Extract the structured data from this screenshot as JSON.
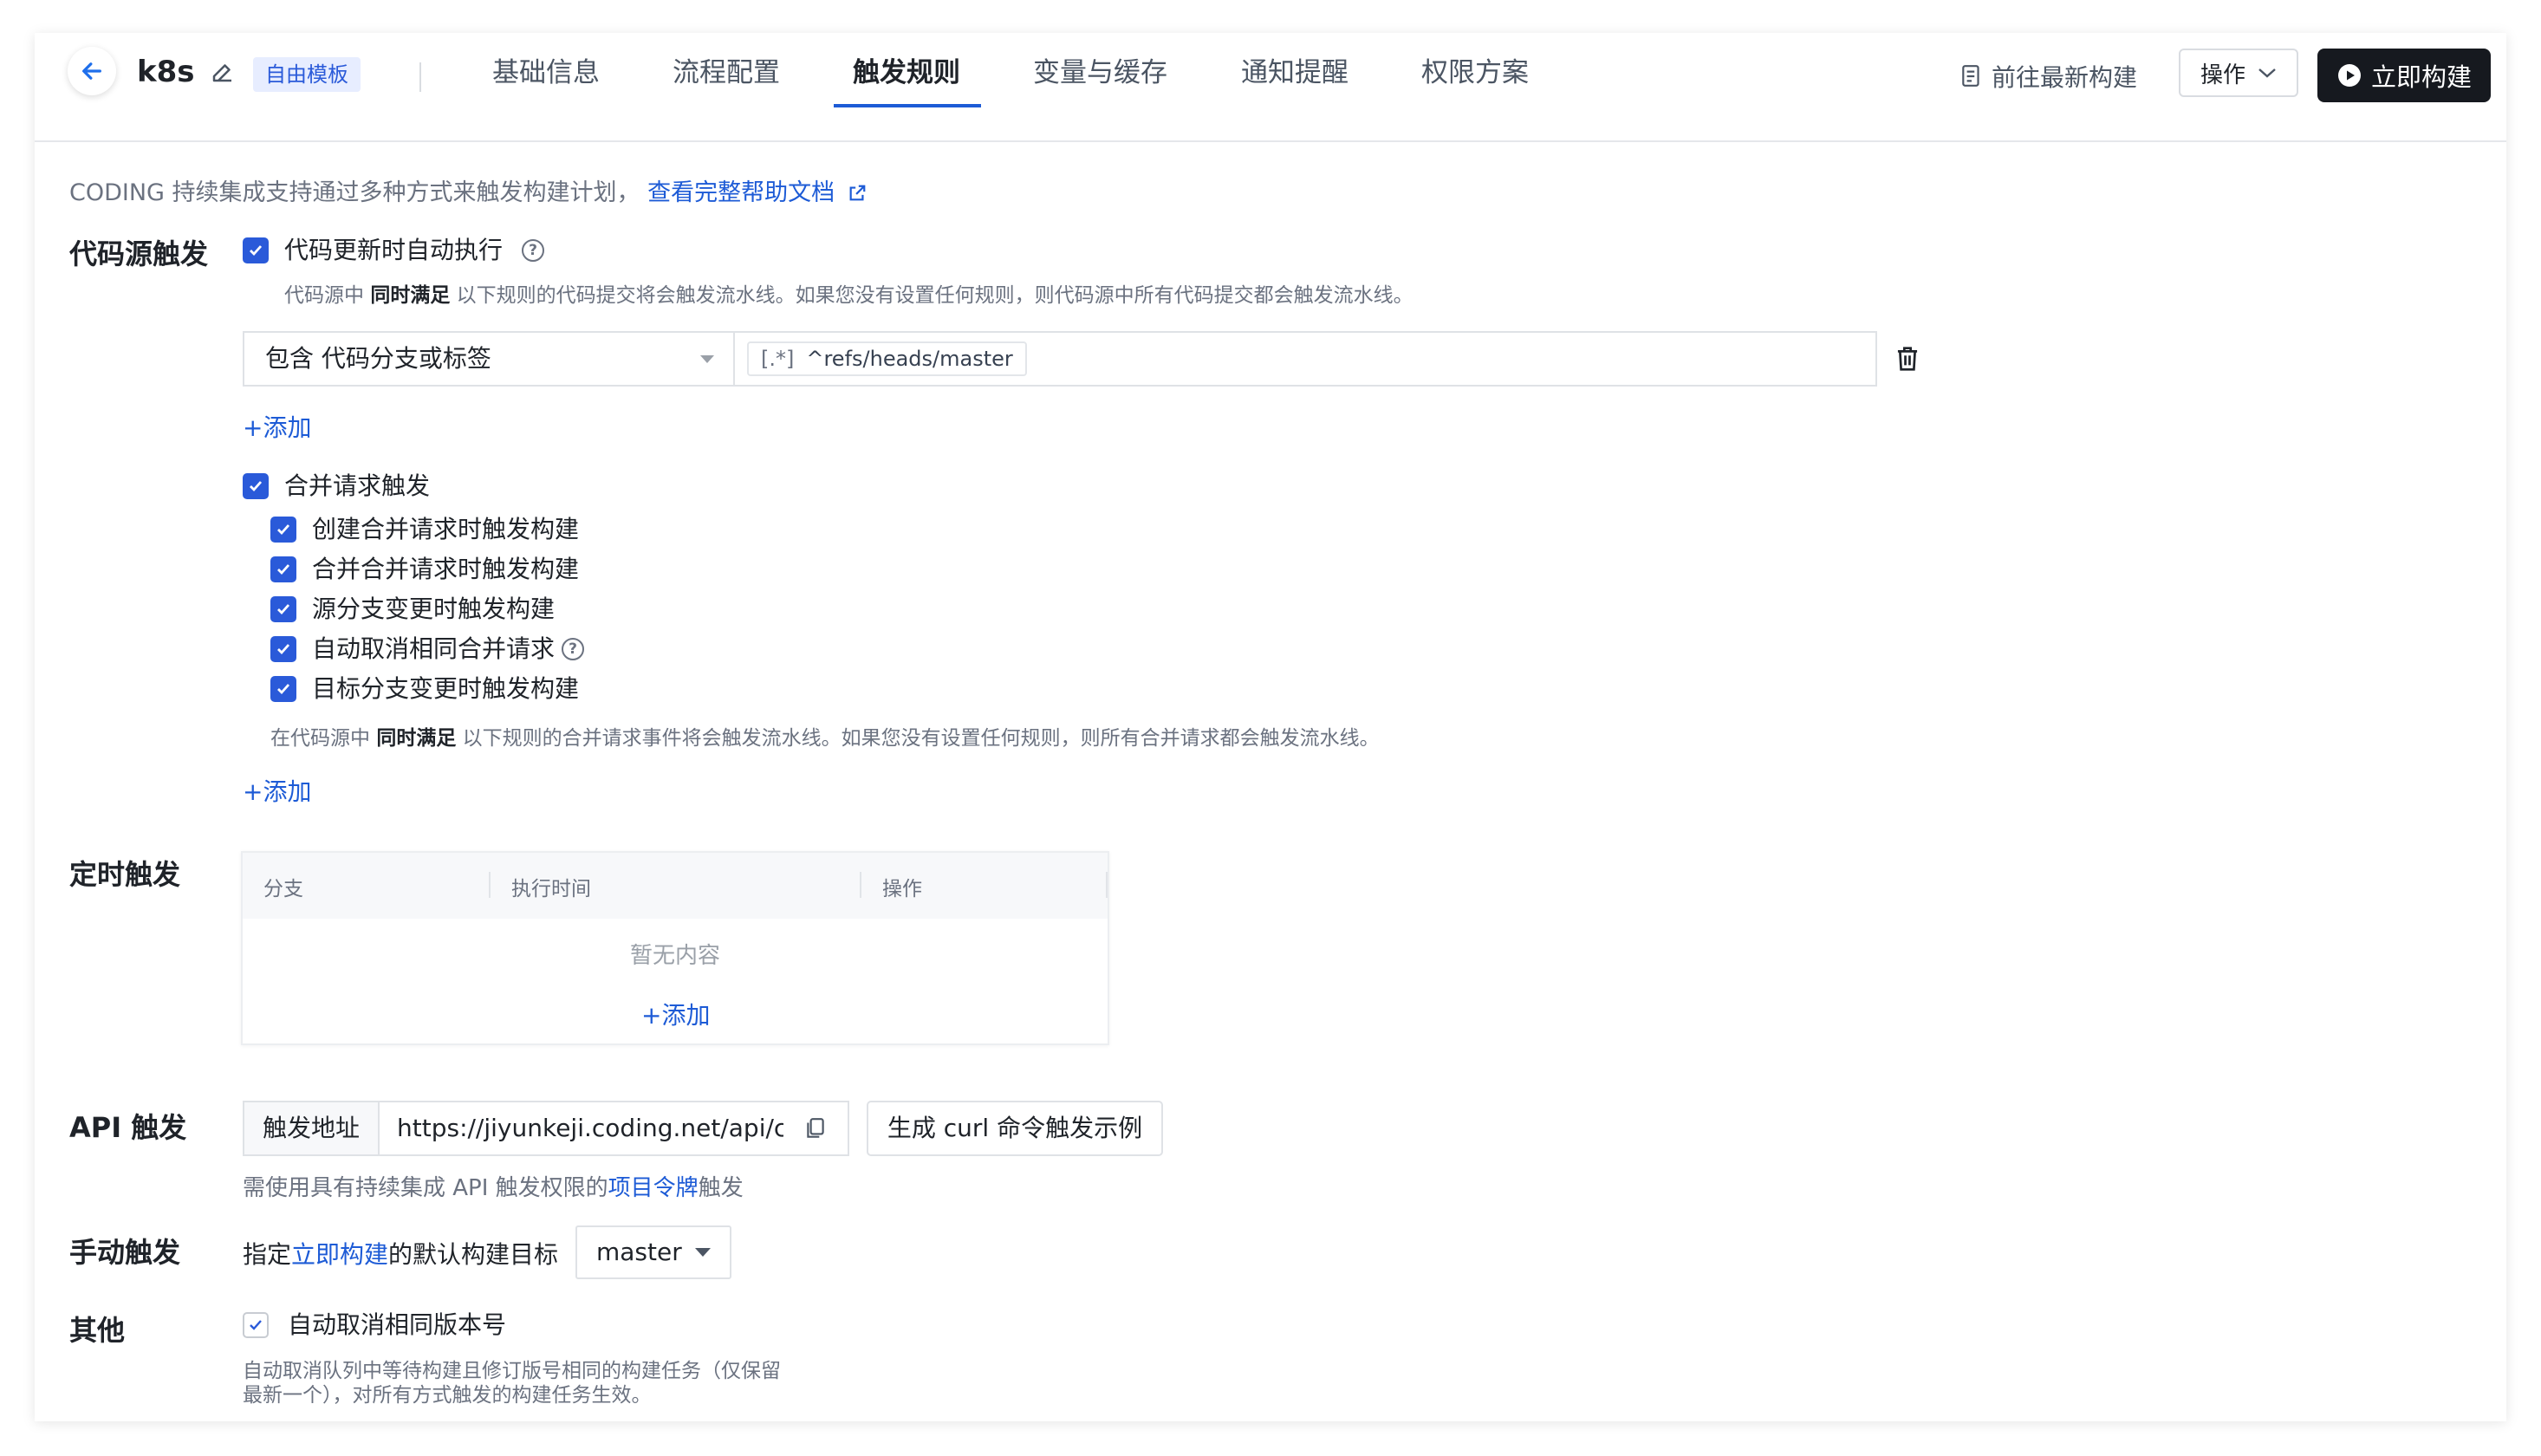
{
  "header": {
    "project_name": "k8s",
    "template_badge": "自由模板",
    "tabs": [
      "基础信息",
      "流程配置",
      "触发规则",
      "变量与缓存",
      "通知提醒",
      "权限方案"
    ],
    "active_tab": "触发规则",
    "goto_latest": "前往最新构建",
    "ops_label": "操作",
    "build_now": "立即构建"
  },
  "intro": {
    "text": "CODING 持续集成支持通过多种方式来触发构建计划，",
    "link": "查看完整帮助文档"
  },
  "code_source": {
    "label": "代码源触发",
    "auto_run_label": "代码更新时自动执行",
    "auto_run_checked": true,
    "note_prefix": "代码源中 ",
    "note_bold": "同时满足",
    "note_suffix": " 以下规则的代码提交将会触发流水线。如果您没有设置任何规则，则代码源中所有代码提交都会触发流水线。",
    "rule_select": "包含 代码分支或标签",
    "rule_regex_icon": "[.*]",
    "rule_value": "^refs/heads/master",
    "add_label": "+添加",
    "mr": {
      "label": "合并请求触发",
      "checked": true,
      "options": [
        {
          "label": "创建合并请求时触发构建",
          "checked": true
        },
        {
          "label": "合并合并请求时触发构建",
          "checked": true
        },
        {
          "label": "源分支变更时触发构建",
          "checked": true
        },
        {
          "label": "自动取消相同合并请求",
          "checked": true
        },
        {
          "label": "目标分支变更时触发构建",
          "checked": true
        }
      ],
      "note_prefix": "在代码源中 ",
      "note_bold": "同时满足",
      "note_suffix": " 以下规则的合并请求事件将会触发流水线。如果您没有设置任何规则，则所有合并请求都会触发流水线。",
      "add_label": "+添加"
    }
  },
  "schedule": {
    "label": "定时触发",
    "columns": [
      "分支",
      "执行时间",
      "操作"
    ],
    "empty_text": "暂无内容",
    "add_label": "+添加"
  },
  "api": {
    "label": "API 触发",
    "prefix": "触发地址",
    "url": "https://jiyunkeji.coding.net/api/cci/job/",
    "curl_button": "生成 curl 命令触发示例",
    "note_prefix": "需使用具有持续集成 API 触发权限的",
    "note_link": "项目令牌",
    "note_suffix": "触发"
  },
  "manual": {
    "label": "手动触发",
    "text_prefix": "指定",
    "text_link": "立即构建",
    "text_suffix": "的默认构建目标",
    "branch": "master"
  },
  "other": {
    "label": "其他",
    "option_label": "自动取消相同版本号",
    "option_checked": true,
    "note": "自动取消队列中等待构建且修订版号相同的构建任务（仅保留最新一个），对所有方式触发的构建任务生效。"
  },
  "colors": {
    "accent": "#2a5ad9",
    "link": "#1d5bd6",
    "primary_button": "#16191f"
  }
}
